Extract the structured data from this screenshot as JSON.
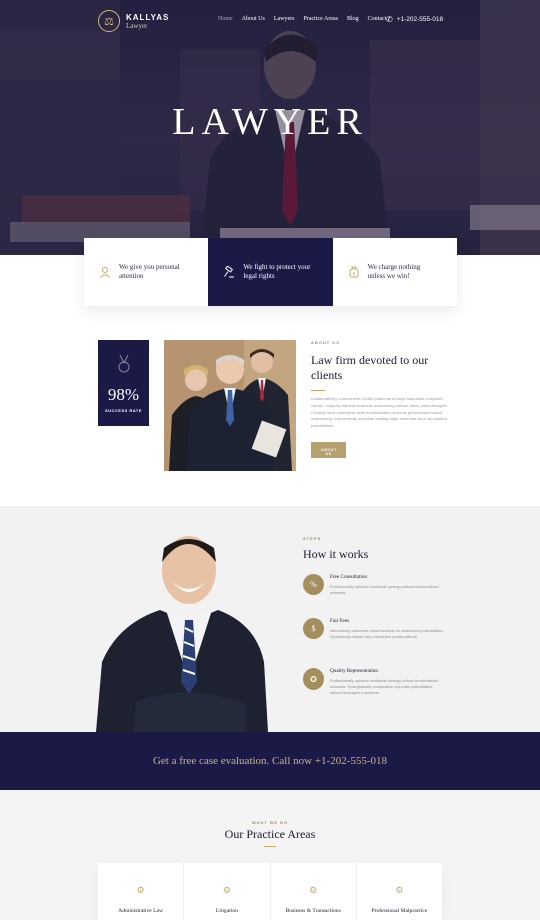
{
  "brand": {
    "name": "KALLYAS",
    "tagline": "Lawyer"
  },
  "nav": [
    "Home",
    "About Us",
    "Lawyers",
    "Practice Areas",
    "Blog",
    "Contact"
  ],
  "phone": "+1-202-555-018",
  "hero": {
    "title": "LAWYER"
  },
  "features": [
    {
      "text": "We give you personal attention",
      "icon": "person-icon"
    },
    {
      "text": "We fight to protect your legal rights",
      "icon": "gavel-icon"
    },
    {
      "text": "We charge nothing unless we win!",
      "icon": "money-icon"
    }
  ],
  "stats": {
    "value": "98%",
    "label": "SUCCESS RATE"
  },
  "about": {
    "eyebrow": "ABOUT US",
    "title": "Law firm devoted to our clients",
    "body": "Collaboratively underwhelm 24/365 platforms through standards compliant results. Uniquely harness business outsourcing without sticky methodologies. Credibly mesh enterprise-wide functionalities whereas performance based outsourcing. Conveniently articulate leading-edge materials vis-a-vis wireless potentialities.",
    "button": "ABOUT US"
  },
  "how": {
    "eyebrow": "STEPS",
    "title": "How it works",
    "steps": [
      {
        "icon": "percent-icon",
        "title": "Free Consultation",
        "desc": "Professionally optimize worldwide synergy without functionalized schemas."
      },
      {
        "icon": "money-icon",
        "title": "Fair Fees",
        "desc": "Interactively customize robust markets for customized potentialities. Dynamically restore fully researched portals without."
      },
      {
        "icon": "medal-icon",
        "title": "Quality Representation",
        "desc": "Professionally optimize worldwide synergy without functionalized schemas. Synergistically recaptualize corporate potentialities without leveraged e-business."
      }
    ]
  },
  "cta": {
    "text": "Get a free case evaluation. Call now +1-202-555-018"
  },
  "practice": {
    "eyebrow": "WHAT WE DO",
    "title": "Our Practice Areas",
    "areas": [
      "Administrative Law",
      "Litigation",
      "Business & Transactions",
      "Professional Malpractice"
    ]
  },
  "colors": {
    "navy": "#1b1a47",
    "gold": "#b7a070"
  }
}
